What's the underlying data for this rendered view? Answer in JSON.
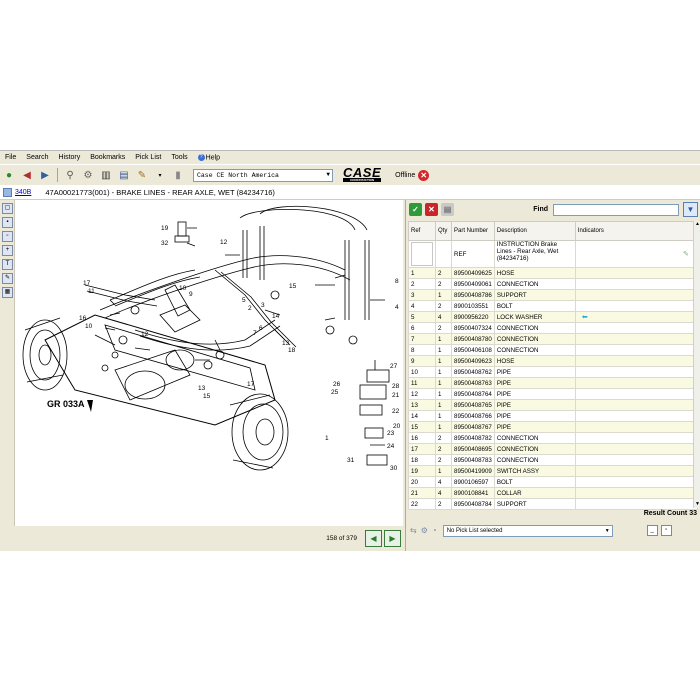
{
  "menu": [
    "File",
    "Search",
    "History",
    "Bookmarks",
    "Pick List",
    "Tools",
    "Help"
  ],
  "toolbar": {
    "region": "Case CE North America",
    "brand": "CASE",
    "brand_sub": "CONSTRUCTION",
    "status": "Offline"
  },
  "title_row": {
    "model": "340B",
    "title": "47A00021773(001) - BRAKE LINES - REAR AXLE, WET (84234716)"
  },
  "diagram": {
    "group_label": "GR 033A",
    "callouts": [
      "19",
      "32",
      "12",
      "17",
      "11",
      "10",
      "9",
      "16",
      "13",
      "18",
      "14",
      "15",
      "5",
      "2",
      "3",
      "1",
      "4",
      "6",
      "7",
      "8",
      "26",
      "25",
      "27",
      "28",
      "21",
      "22",
      "23",
      "24",
      "31",
      "30",
      "20"
    ]
  },
  "left_status": {
    "page": "158 of 379"
  },
  "parts": {
    "find_label": "Find",
    "columns": [
      "Ref",
      "Qty",
      "Part Number",
      "Description",
      "Indicators"
    ],
    "ref_row": {
      "ref": "",
      "qty": "",
      "part": "REF",
      "desc": "INSTRUCTION Brake Lines - Rear Axle, Wet (84234716)"
    },
    "rows": [
      {
        "ref": "1",
        "qty": "2",
        "part": "89500409625",
        "desc": "HOSE"
      },
      {
        "ref": "2",
        "qty": "2",
        "part": "89500409061",
        "desc": "CONNECTION"
      },
      {
        "ref": "3",
        "qty": "1",
        "part": "89500408786",
        "desc": "SUPPORT"
      },
      {
        "ref": "4",
        "qty": "2",
        "part": "8900103551",
        "desc": "BOLT"
      },
      {
        "ref": "5",
        "qty": "4",
        "part": "8900956220",
        "desc": "LOCK WASHER",
        "indicator": "arrow"
      },
      {
        "ref": "6",
        "qty": "2",
        "part": "89500407324",
        "desc": "CONNECTION"
      },
      {
        "ref": "7",
        "qty": "1",
        "part": "89500408780",
        "desc": "CONNECTION"
      },
      {
        "ref": "8",
        "qty": "1",
        "part": "89500406108",
        "desc": "CONNECTION"
      },
      {
        "ref": "9",
        "qty": "1",
        "part": "89500409623",
        "desc": "HOSE"
      },
      {
        "ref": "10",
        "qty": "1",
        "part": "89500408762",
        "desc": "PIPE"
      },
      {
        "ref": "11",
        "qty": "1",
        "part": "89500408763",
        "desc": "PIPE"
      },
      {
        "ref": "12",
        "qty": "1",
        "part": "89500408764",
        "desc": "PIPE"
      },
      {
        "ref": "13",
        "qty": "1",
        "part": "89500408765",
        "desc": "PIPE"
      },
      {
        "ref": "14",
        "qty": "1",
        "part": "89500408766",
        "desc": "PIPE"
      },
      {
        "ref": "15",
        "qty": "1",
        "part": "89500408767",
        "desc": "PIPE"
      },
      {
        "ref": "16",
        "qty": "2",
        "part": "89500408782",
        "desc": "CONNECTION"
      },
      {
        "ref": "17",
        "qty": "2",
        "part": "89500408695",
        "desc": "CONNECTION"
      },
      {
        "ref": "18",
        "qty": "2",
        "part": "89500408783",
        "desc": "CONNECTION"
      },
      {
        "ref": "19",
        "qty": "1",
        "part": "89500419909",
        "desc": "SWITCH ASSY"
      },
      {
        "ref": "20",
        "qty": "4",
        "part": "8900106597",
        "desc": "BOLT"
      },
      {
        "ref": "21",
        "qty": "4",
        "part": "8900108841",
        "desc": "COLLAR"
      },
      {
        "ref": "22",
        "qty": "2",
        "part": "89500408784",
        "desc": "SUPPORT"
      }
    ],
    "result_count": "Result Count 33",
    "picklist": "No Pick List selected"
  }
}
